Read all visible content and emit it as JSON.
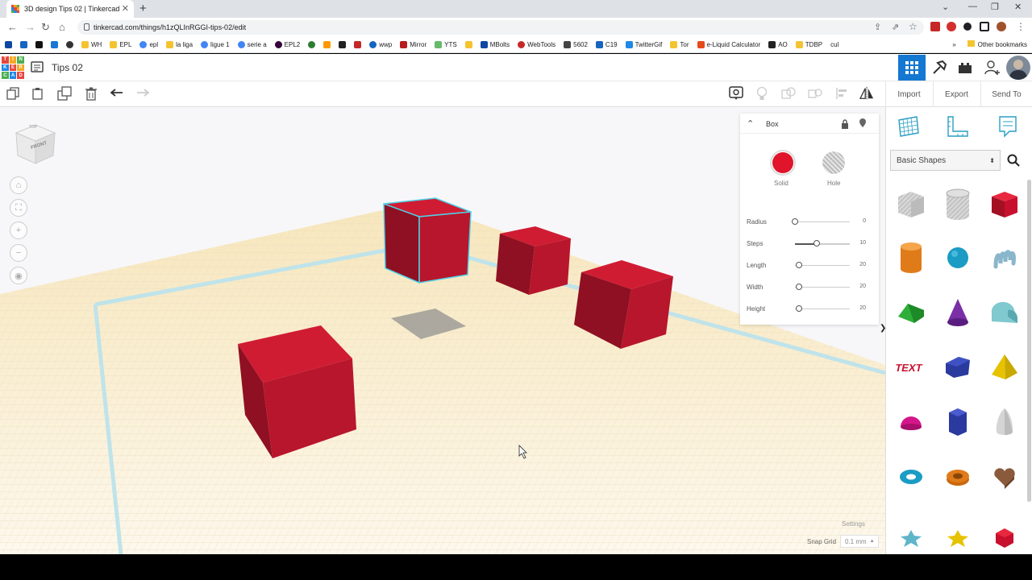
{
  "browser": {
    "tab_title": "3D design Tips 02 | Tinkercad",
    "url": "tinkercad.com/things/h1zQLInRGGI-tips-02/edit",
    "bookmarks": [
      "WH",
      "EPL",
      "epl",
      "la liga",
      "ligue 1",
      "serie a",
      "EPL2",
      "",
      "",
      "",
      "",
      "wwp",
      "Mirror",
      "YTS",
      "",
      "MBolts",
      "WebTools",
      "5602",
      "C19",
      "TwitterGif",
      "Tor",
      "e-Liquid Calculator",
      "AO",
      "TDBP",
      "cul"
    ],
    "other_bookmarks": "Other bookmarks",
    "more_bookmarks": "»"
  },
  "app": {
    "title": "Tips 02",
    "logo_letters": [
      "TIN",
      "KER",
      "CAD"
    ],
    "actions": {
      "import": "Import",
      "export": "Export",
      "send_to": "Send To"
    }
  },
  "viewcube": {
    "label": "FRONT",
    "top": "TOP"
  },
  "inspector": {
    "title": "Box",
    "solid_label": "Solid",
    "hole_label": "Hole",
    "solid_color": "#e0142a",
    "params": [
      {
        "label": "Radius",
        "value": "0",
        "level": 0.0
      },
      {
        "label": "Steps",
        "value": "10",
        "level": 0.4
      },
      {
        "label": "Length",
        "value": "20",
        "level": 0.07
      },
      {
        "label": "Width",
        "value": "20",
        "level": 0.07
      },
      {
        "label": "Height",
        "value": "20",
        "level": 0.07
      }
    ],
    "collapse_glyph": "❯"
  },
  "library": {
    "category": "Basic Shapes",
    "shapes": [
      "box-hole",
      "cylinder-hole",
      "box",
      "cylinder",
      "sphere",
      "scribble",
      "roof",
      "cone",
      "round-roof",
      "text",
      "polygon",
      "pyramid",
      "half-sphere",
      "hexagonal-prism",
      "paraboloid",
      "torus",
      "tube",
      "heart",
      "star",
      "star-yellow",
      "icosahedron"
    ]
  },
  "footer": {
    "settings": "Settings",
    "snap_grid_label": "Snap Grid",
    "snap_grid_value": "0.1 mm"
  },
  "colors": {
    "accent": "#1477d1",
    "box_red": "#c8102e",
    "grid_bg": "#fbf3de"
  }
}
